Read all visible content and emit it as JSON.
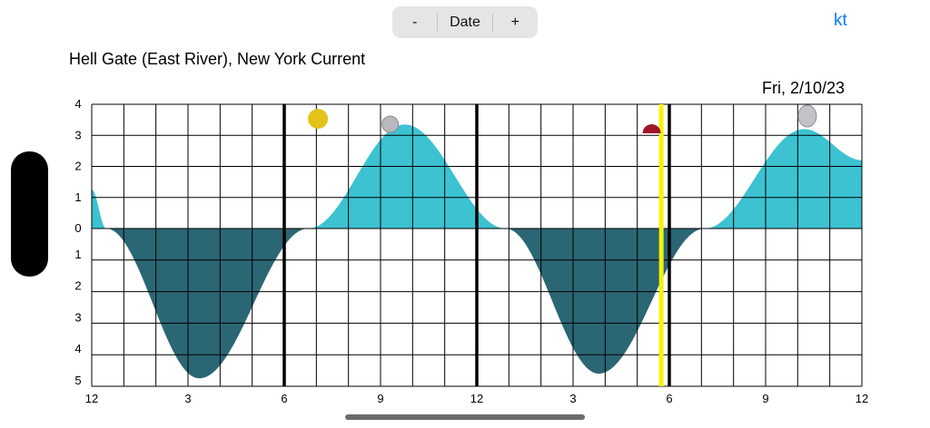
{
  "toolbar": {
    "decrement_label": "-",
    "date_label": "Date",
    "increment_label": "+",
    "unit_label": "kt"
  },
  "header": {
    "station": "Hell Gate (East River), New York Current",
    "date": "Fri, 2/10/23"
  },
  "chart_data": {
    "type": "area",
    "x_tick_labels": [
      "12",
      "3",
      "6",
      "9",
      "12",
      "3",
      "6",
      "9",
      "12"
    ],
    "y_tick_labels_upper": [
      "4",
      "3",
      "2",
      "1",
      "0"
    ],
    "y_tick_labels_lower": [
      "1",
      "2",
      "3",
      "4",
      "5"
    ],
    "xlim_hours": [
      0,
      24
    ],
    "ylim_knots": [
      -5,
      4
    ],
    "grid": true,
    "flood_color": "#3cc2d1",
    "ebb_color": "#2b6674",
    "series": [
      {
        "values": [
          {
            "x": 0,
            "y": 1.25
          },
          {
            "x": 0.45,
            "y": 0
          },
          {
            "x": 3.35,
            "y": -4.75
          },
          {
            "x": 6.75,
            "y": 0
          },
          {
            "x": 9.75,
            "y": 3.35
          },
          {
            "x": 12.9,
            "y": 0
          },
          {
            "x": 15.8,
            "y": -4.6
          },
          {
            "x": 19.1,
            "y": 0
          },
          {
            "x": 22.2,
            "y": 3.2
          },
          {
            "x": 24,
            "y": 2.2
          }
        ]
      }
    ],
    "current_time_hours": 17.75,
    "day_boundary_hours": [
      6,
      12,
      18
    ],
    "sunrise_hours": 7.05,
    "sunset_hours": 17.45,
    "moonrise_hours": 9.3,
    "moonset_hours": 22.3,
    "sun_color": "#e3c21a",
    "sunset_color": "#a0152a",
    "current_time_color": "#f5f20a"
  }
}
